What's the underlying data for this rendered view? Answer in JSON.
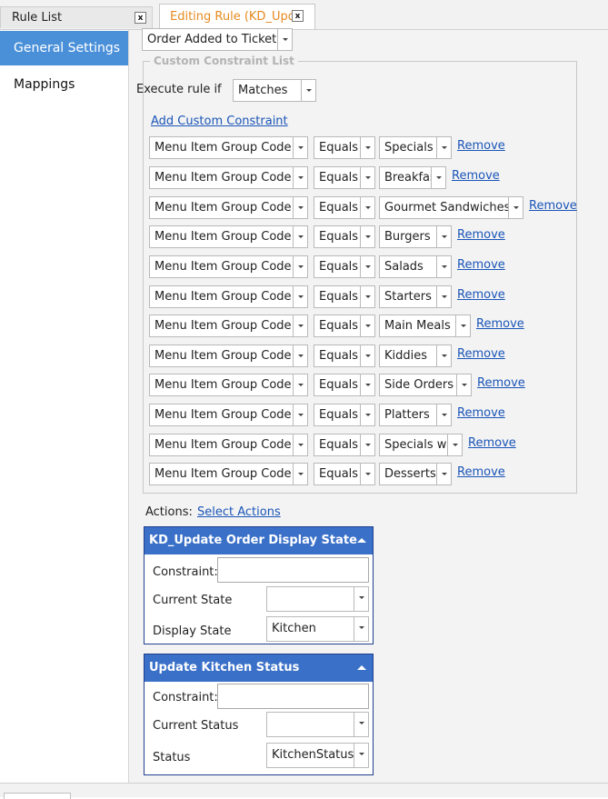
{
  "tabs": {
    "rule_list": "Rule List",
    "editing": "Editing Rule (KD_Upda",
    "close": "x"
  },
  "sidebar": {
    "items": [
      {
        "label": "General Settings"
      },
      {
        "label": "Mappings"
      }
    ]
  },
  "trigger": {
    "value": "Order Added to Ticket"
  },
  "constraints": {
    "legend": "Custom Constraint List",
    "execute_label": "Execute rule if",
    "execute_value": "Matches",
    "add_link": "Add Custom Constraint",
    "remove_label": "Remove",
    "rows": [
      {
        "field": "Menu Item Group Code",
        "op": "Equals",
        "value": "Specials"
      },
      {
        "field": "Menu Item Group Code",
        "op": "Equals",
        "value": "Breakfast"
      },
      {
        "field": "Menu Item Group Code",
        "op": "Equals",
        "value": "Gourmet Sandwiches"
      },
      {
        "field": "Menu Item Group Code",
        "op": "Equals",
        "value": "Burgers"
      },
      {
        "field": "Menu Item Group Code",
        "op": "Equals",
        "value": "Salads"
      },
      {
        "field": "Menu Item Group Code",
        "op": "Equals",
        "value": "Starters"
      },
      {
        "field": "Menu Item Group Code",
        "op": "Equals",
        "value": "Main Meals"
      },
      {
        "field": "Menu Item Group Code",
        "op": "Equals",
        "value": "Kiddies"
      },
      {
        "field": "Menu Item Group Code",
        "op": "Equals",
        "value": "Side Orders"
      },
      {
        "field": "Menu Item Group Code",
        "op": "Equals",
        "value": "Platters"
      },
      {
        "field": "Menu Item Group Code",
        "op": "Equals",
        "value": "Specials w"
      },
      {
        "field": "Menu Item Group Code",
        "op": "Equals",
        "value": "Desserts"
      }
    ]
  },
  "actions": {
    "label": "Actions:",
    "select_link": "Select Actions",
    "cards": [
      {
        "title": "KD_Update Order Display State",
        "constraint_label": "Constraint:",
        "constraint_value": "",
        "state_label": "Current State",
        "state_value": "",
        "display_label": "Display State",
        "display_value": "Kitchen"
      },
      {
        "title": "Update Kitchen Status",
        "constraint_label": "Constraint:",
        "constraint_value": "",
        "state_label": "Current Status",
        "state_value": "",
        "display_label": "Status",
        "display_value": "KitchenStatus"
      }
    ]
  },
  "colors": {
    "accent": "#4a90d9",
    "tab_active_text": "#e58a1f",
    "card_header": "#3a70c8",
    "link": "#1a55b8"
  }
}
